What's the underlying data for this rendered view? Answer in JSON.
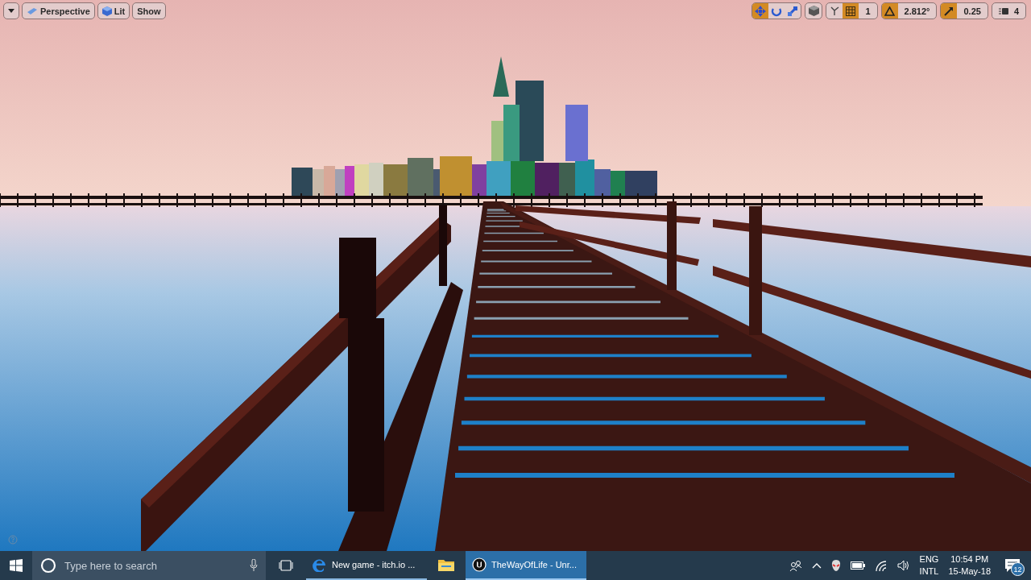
{
  "viewport": {
    "toolbar_left": [
      {
        "kind": "menu"
      },
      {
        "kind": "perspective",
        "label": "Perspective"
      },
      {
        "kind": "lit",
        "label": "Lit"
      },
      {
        "kind": "plain",
        "label": "Show"
      }
    ],
    "transform_modes": [
      {
        "kind": "translate",
        "selected": true
      },
      {
        "kind": "rotate",
        "selected": false
      },
      {
        "kind": "scale",
        "selected": false
      }
    ],
    "snaps": [
      {
        "kind": "grid",
        "on": true,
        "value": "1"
      },
      {
        "kind": "rotation",
        "on": true,
        "value": "2.812°"
      },
      {
        "kind": "scale",
        "on": true,
        "value": "0.25"
      }
    ],
    "camera_speed": "4"
  },
  "taskbar": {
    "search": {
      "placeholder": "Type here to search"
    },
    "apps": [
      {
        "kind": "edge",
        "label": "New game - itch.io ...",
        "selected": false
      },
      {
        "kind": "explorer",
        "selected": false
      },
      {
        "kind": "unreal",
        "label": "TheWayOfLife - Unr...",
        "selected": true
      }
    ],
    "language": [
      "ENG",
      "INTL"
    ],
    "time": "10:54 PM",
    "date": "15-May-18",
    "notifications": "12"
  }
}
